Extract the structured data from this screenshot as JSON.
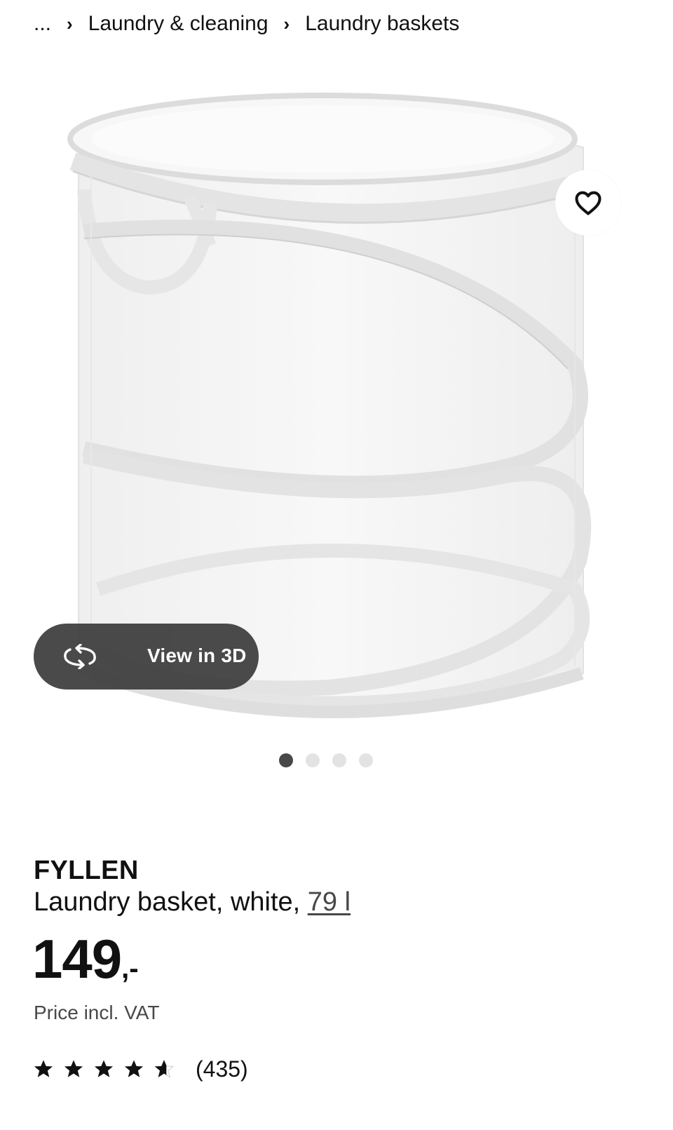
{
  "breadcrumb": {
    "ellipsis": "...",
    "items": [
      {
        "label": "Laundry & cleaning"
      },
      {
        "label": "Laundry baskets"
      }
    ]
  },
  "gallery": {
    "view3d_label": "View in 3D",
    "image_count": 4,
    "active_index": 0
  },
  "product": {
    "name": "FYLLEN",
    "description": "Laundry basket, white, ",
    "size_link": "79 l",
    "price_main": "149",
    "price_suffix": ",-",
    "price_note": "Price incl. VAT",
    "rating": {
      "value": 4.6,
      "max": 5,
      "count_label": "(435)"
    }
  },
  "colors": {
    "text": "#111111",
    "muted": "#484848",
    "dot_inactive": "#e3e3e3",
    "dot_active": "#484848",
    "pill_bg": "#3c3c3c"
  },
  "icons": {
    "favorite": "heart-icon",
    "view3d": "rotate-3d-icon",
    "breadcrumb_sep": "chevron-right-icon",
    "star": "star-icon"
  }
}
